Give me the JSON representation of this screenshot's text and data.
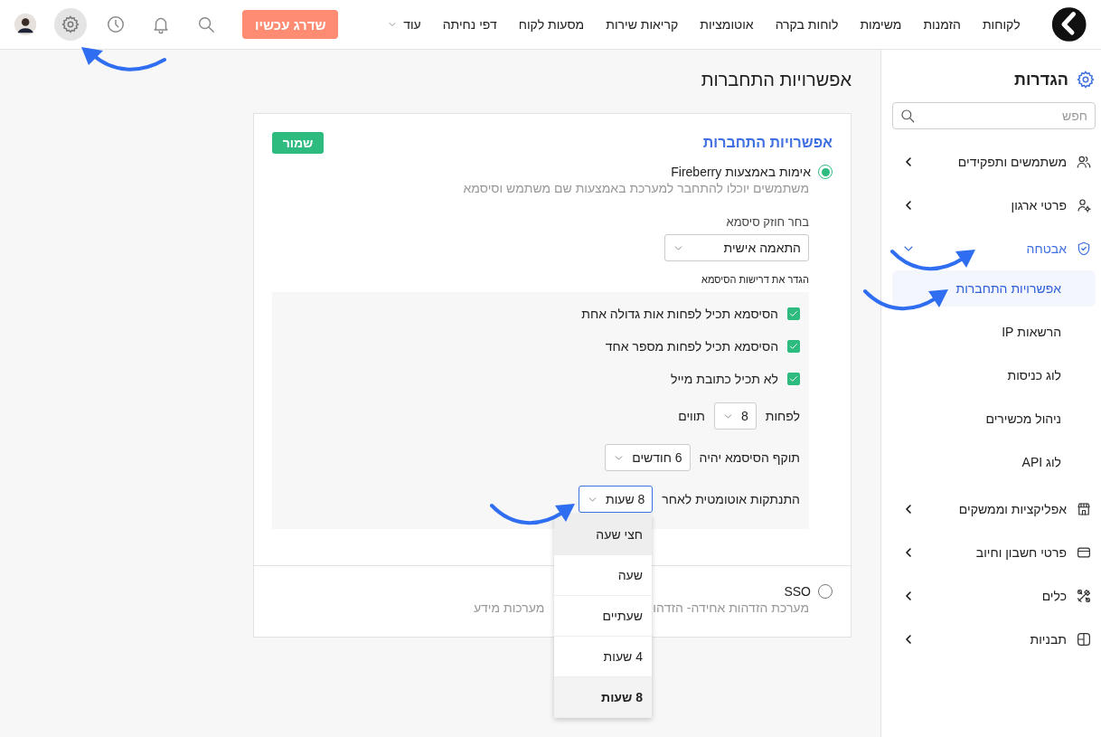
{
  "top_nav": {
    "items": [
      {
        "label": "לקוחות",
        "kind": "link"
      },
      {
        "label": "הזמנות",
        "kind": "link"
      },
      {
        "label": "משימות",
        "kind": "link"
      },
      {
        "label": "לוחות בקרה",
        "kind": "link"
      },
      {
        "label": "אוטומציות",
        "kind": "link"
      },
      {
        "label": "קריאות שירות",
        "kind": "link"
      },
      {
        "label": "מסעות לקוח",
        "kind": "link"
      },
      {
        "label": "דפי נחיתה",
        "kind": "link"
      },
      {
        "label": "עוד",
        "kind": "menu"
      }
    ],
    "upgrade_button": "שדרג עכשיו",
    "icons": [
      {
        "kind": "search",
        "selected": false
      },
      {
        "kind": "bell",
        "selected": false
      },
      {
        "kind": "clock",
        "selected": false
      },
      {
        "kind": "gear",
        "selected": true
      }
    ]
  },
  "sidebar": {
    "title": "הגדרות",
    "search": {
      "placeholder": "חפש"
    },
    "items": [
      {
        "label": "משתמשים ותפקידים",
        "expanded": false
      },
      {
        "label": "פרטי ארגון",
        "expanded": false
      },
      {
        "label": "אבטחה",
        "expanded": true,
        "children": [
          {
            "label": "אפשרויות התחברות",
            "selected": true
          },
          {
            "label": "הרשאות IP",
            "selected": false
          },
          {
            "label": "לוג כניסות",
            "selected": false
          },
          {
            "label": "ניהול מכשירים",
            "selected": false
          },
          {
            "label": "לוג API",
            "selected": false
          }
        ]
      },
      {
        "label": "אפליקציות וממשקים",
        "expanded": false
      },
      {
        "label": "פרטי חשבון וחיוב",
        "expanded": false
      },
      {
        "label": "כלים",
        "expanded": false
      },
      {
        "label": "תבניות",
        "expanded": false
      }
    ]
  },
  "page_title": "אפשרויות התחברות",
  "card": {
    "title": "אפשרויות התחברות",
    "save_button": "שמור",
    "options": [
      {
        "label": "אימות באמצעות Fireberry",
        "selected": true,
        "description": "משתמשים יוכלו להתחבר למערכת באמצעות שם משתמש וסיסמא"
      },
      {
        "label": "SSO",
        "selected": false,
        "description_start": "מערכת הזדהות אחידה- הזדהו",
        "description_end": "מערכות מידע"
      }
    ],
    "strength_label": "בחר חוזק סיסמא",
    "strength_value": "התאמה אישית",
    "requirements_label": "הגדר את דרישות הסיסמא",
    "requirements": [
      {
        "kind": "checkbox",
        "label": "הסיסמא תכיל לפחות אות גדולה אחת",
        "checked": true
      },
      {
        "kind": "checkbox",
        "label": "הסיסמא תכיל לפחות מספר אחד",
        "checked": true
      },
      {
        "kind": "checkbox",
        "label": "לא תכיל כתובת מייל",
        "checked": true
      },
      {
        "kind": "select",
        "before": "לפחות",
        "value": "8",
        "after": "תווים",
        "open": false
      },
      {
        "kind": "select",
        "before": "תוקף הסיסמא יהיה",
        "value": "6 חודשים",
        "open": false
      },
      {
        "kind": "select",
        "before": "התנתקות אוטומטית לאחר",
        "value": "8 שעות",
        "open": true,
        "options": [
          {
            "label": "חצי שעה",
            "selected": false,
            "hovered": true
          },
          {
            "label": "שעה",
            "selected": false,
            "hovered": false
          },
          {
            "label": "שעתיים",
            "selected": false,
            "hovered": false
          },
          {
            "label": "4 שעות",
            "selected": false,
            "hovered": false
          },
          {
            "label": "8 שעות",
            "selected": true,
            "hovered": false
          }
        ]
      }
    ]
  }
}
